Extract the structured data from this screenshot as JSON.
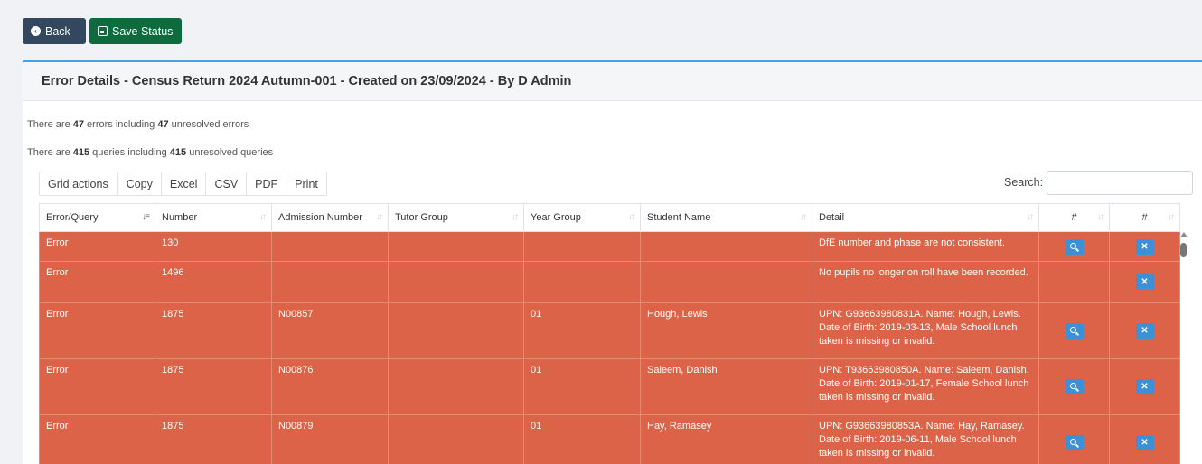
{
  "toolbar": {
    "back_label": "Back",
    "save_label": "Save Status"
  },
  "card": {
    "title": "Error Details - Census Return 2024 Autumn-001 - Created on 23/09/2024 - By D Admin"
  },
  "summary": {
    "errors_pre": "There are ",
    "errors_count": "47",
    "errors_mid": " errors including ",
    "errors_unresolved": "47",
    "errors_post": " unresolved errors",
    "queries_pre": "There are ",
    "queries_count": "415",
    "queries_mid": " queries including ",
    "queries_unresolved": "415",
    "queries_post": " unresolved queries"
  },
  "grid_actions": {
    "title": "Grid actions",
    "items": [
      "Copy",
      "Excel",
      "CSV",
      "PDF",
      "Print"
    ]
  },
  "search": {
    "label": "Search:",
    "value": "",
    "placeholder": ""
  },
  "table": {
    "columns": [
      "Error/Query",
      "Number",
      "Admission Number",
      "Tutor Group",
      "Year Group",
      "Student Name",
      "Detail",
      "#",
      "#"
    ],
    "rows": [
      {
        "type": "Error",
        "number": "130",
        "admission": "",
        "tutor": "",
        "year": "",
        "name": "",
        "detail": "DfE number and phase are not consistent.",
        "has_view": true
      },
      {
        "type": "Error",
        "number": "1496",
        "admission": "",
        "tutor": "",
        "year": "",
        "name": "",
        "detail": "No pupils no longer on roll have been recorded.",
        "has_view": false
      },
      {
        "type": "Error",
        "number": "1875",
        "admission": "N00857",
        "tutor": "",
        "year": "01",
        "name": "Hough, Lewis",
        "detail": "UPN: G93663980831A. Name: Hough, Lewis. Date of Birth: 2019-03-13, Male School lunch taken is missing or invalid.",
        "has_view": true
      },
      {
        "type": "Error",
        "number": "1875",
        "admission": "N00876",
        "tutor": "",
        "year": "01",
        "name": "Saleem, Danish",
        "detail": "UPN: T93663980850A. Name: Saleem, Danish. Date of Birth: 2019-01-17, Female School lunch taken is missing or invalid.",
        "has_view": true
      },
      {
        "type": "Error",
        "number": "1875",
        "admission": "N00879",
        "tutor": "",
        "year": "01",
        "name": "Hay, Ramasey",
        "detail": "UPN: G93663980853A. Name: Hay, Ramasey. Date of Birth: 2019-06-11, Male School lunch taken is missing or invalid.",
        "has_view": true
      }
    ]
  },
  "colors": {
    "error_row": "#dc6347",
    "accent": "#4a9fe0",
    "back_btn": "#33475e",
    "save_btn": "#0d6b3e",
    "action_btn": "#3d8fd6"
  }
}
